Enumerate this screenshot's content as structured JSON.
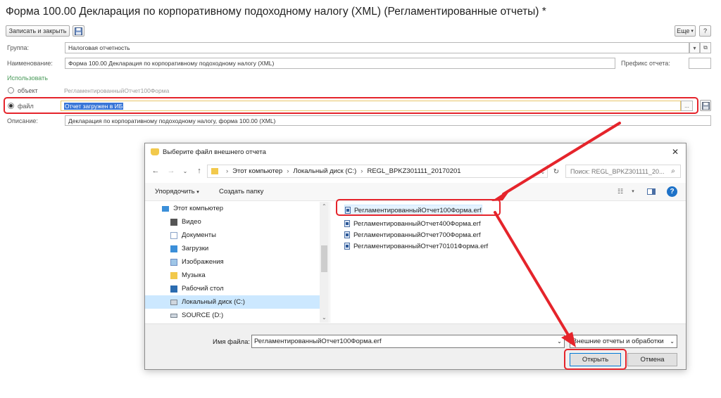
{
  "form": {
    "title": "Форма 100.00 Декларация по корпоративному подоходному налогу (XML) (Регламентированные отчеты) *",
    "save_close_label": "Записать и закрыть",
    "more_label": "Еще",
    "help_label": "?",
    "group_label": "Группа:",
    "group_value": "Налоговая отчетность",
    "name_label": "Наименование:",
    "name_value": "Форма 100.00 Декларация по корпоративному подоходному налогу (XML)",
    "prefix_label": "Префикс отчета:",
    "prefix_value": "",
    "use_label": "Использовать",
    "object_label": "объект",
    "object_value": "РегламентированныйОтчет100Форма",
    "file_label": "файл",
    "file_value": "Отчет загружен в ИБ",
    "select_btn_label": "...",
    "description_label": "Описание:",
    "description_value": "Декларация по корпоративному подоходному налогу, форма 100.00 (XML)"
  },
  "dialog": {
    "title": "Выберите файл внешнего отчета",
    "close_label": "✕",
    "path_parts": [
      "Этот компьютер",
      "Локальный диск (C:)",
      "REGL_BPKZ301111_20170201"
    ],
    "search_placeholder": "Поиск: REGL_BPKZ301111_20...",
    "organize_label": "Упорядочить",
    "new_folder_label": "Создать папку",
    "nav_items": [
      {
        "label": "Этот компьютер"
      },
      {
        "label": "Видео"
      },
      {
        "label": "Документы"
      },
      {
        "label": "Загрузки"
      },
      {
        "label": "Изображения"
      },
      {
        "label": "Музыка"
      },
      {
        "label": "Рабочий стол"
      },
      {
        "label": "Локальный диск (C:)"
      },
      {
        "label": "SOURCE (D:)"
      }
    ],
    "files": [
      {
        "name": "РегламентированныйОтчет100Форма.erf"
      },
      {
        "name": "РегламентированныйОтчет400Форма.erf"
      },
      {
        "name": "РегламентированныйОтчет700Форма.erf"
      },
      {
        "name": "РегламентированныйОтчет70101Форма.erf"
      }
    ],
    "filename_label": "Имя файла:",
    "filename_value": "РегламентированныйОтчет100Форма.erf",
    "filter_value": "Внешние отчеты и обработки",
    "open_label": "Открыть",
    "cancel_label": "Отмена"
  },
  "colors": {
    "highlight_red": "#e5242b",
    "selection_blue": "#cce8ff",
    "use_green": "#4a9a5a"
  }
}
